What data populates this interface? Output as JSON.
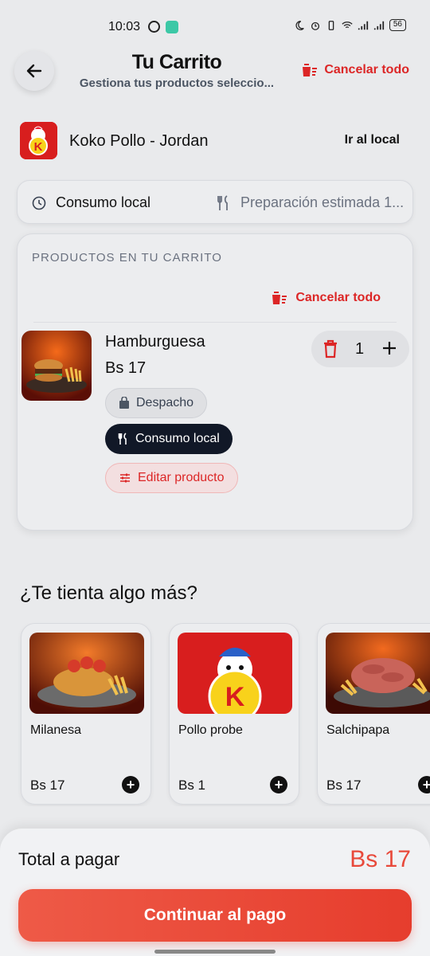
{
  "status_bar": {
    "time": "10:03",
    "battery": "56"
  },
  "header": {
    "title": "Tu Carrito",
    "subtitle": "Gestiona tus productos seleccio...",
    "cancel_all": "Cancelar todo"
  },
  "store": {
    "name": "Koko Pollo - Jordan",
    "link": "Ir al local",
    "logo_letter": "K"
  },
  "info": {
    "mode": "Consumo local",
    "prep": "Preparación estimada 1..."
  },
  "cart": {
    "heading": "PRODUCTOS EN TU CARRITO",
    "cancel_all": "Cancelar todo",
    "item": {
      "name": "Hamburguesa",
      "price": "Bs 17",
      "qty": "1",
      "chip_delivery": "Despacho",
      "chip_local": "Consumo local",
      "edit": "Editar producto"
    }
  },
  "suggestions": {
    "title": "¿Te tienta algo más?",
    "items": [
      {
        "name": "Milanesa",
        "price": "Bs 17"
      },
      {
        "name": "Pollo probe",
        "price": "Bs 1"
      },
      {
        "name": "Salchipapa",
        "price": "Bs 17"
      }
    ]
  },
  "footer": {
    "total_label": "Total a pagar",
    "total_value": "Bs 17",
    "pay_button": "Continuar al pago"
  },
  "colors": {
    "accent": "#dc2626",
    "button": "#e8493a",
    "dark_chip": "#111827"
  }
}
